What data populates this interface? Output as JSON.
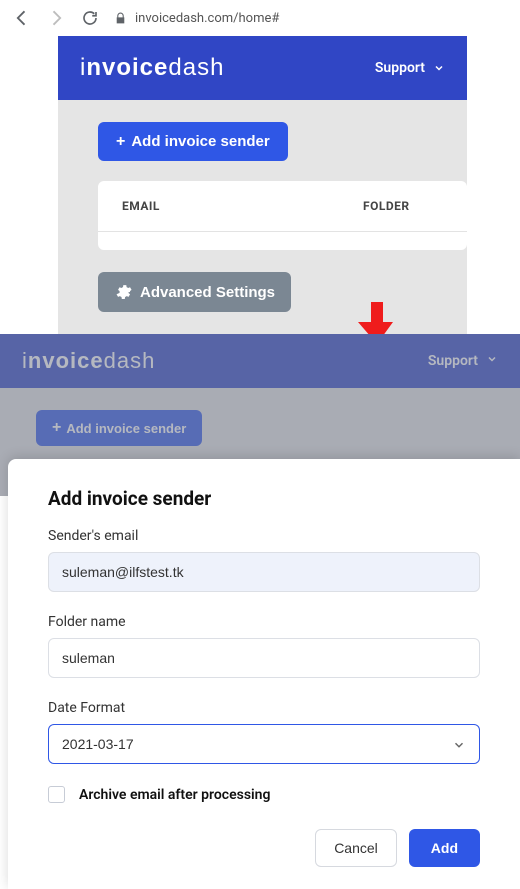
{
  "browser": {
    "url": "invoicedash.com/home#"
  },
  "brand": "invoicedash",
  "support_label": "Support",
  "panel1": {
    "add_button": "Add invoice sender",
    "columns": {
      "email": "EMAIL",
      "folder": "FOLDER"
    },
    "advanced_button": "Advanced Settings"
  },
  "panel2": {
    "add_button": "Add invoice sender"
  },
  "dialog": {
    "title": "Add invoice sender",
    "sender_label": "Sender's email",
    "sender_value": "suleman@ilfstest.tk",
    "folder_label": "Folder name",
    "folder_value": "suleman",
    "date_label": "Date Format",
    "date_value": "2021-03-17",
    "archive_label": "Archive email after processing",
    "cancel": "Cancel",
    "add": "Add"
  }
}
